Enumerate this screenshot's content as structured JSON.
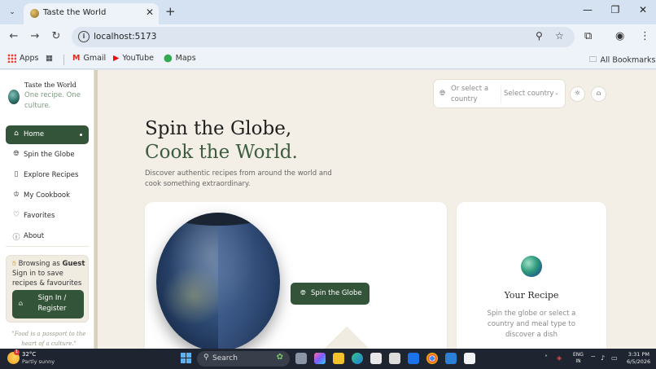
{
  "browser": {
    "tab_title": "Taste the World",
    "tab_close": "✕",
    "new_tab": "+",
    "url": "localhost:5173",
    "bookmarks": {
      "apps": "Apps",
      "gmail": "Gmail",
      "youtube": "YouTube",
      "maps": "Maps",
      "all_bookmarks": "All Bookmarks"
    }
  },
  "sidebar": {
    "brand_name": "Taste the World",
    "tagline": "One recipe. One culture.",
    "nav": [
      {
        "label": "Home",
        "icon": "home-icon"
      },
      {
        "label": "Spin the Globe",
        "icon": "globe-icon"
      },
      {
        "label": "Explore Recipes",
        "icon": "book-icon"
      },
      {
        "label": "My Cookbook",
        "icon": "chef-hat-icon"
      },
      {
        "label": "Favorites",
        "icon": "heart-icon"
      },
      {
        "label": "About",
        "icon": "info-icon"
      }
    ],
    "guest": {
      "prefix": "Browsing as ",
      "role": "Guest",
      "message": "Sign in to save recipes & favourites",
      "signin_label": "Sign In / Register"
    },
    "quote": "\"Food is a passport to the heart of a culture.\""
  },
  "header": {
    "country_placeholder": "Or select a country",
    "country_select": "Select country"
  },
  "hero": {
    "title_line1": "Spin the Globe,",
    "title_line2": "Cook the World.",
    "description": "Discover authentic recipes from around the world and cook something extraordinary."
  },
  "globe_card": {
    "spin_label": "Spin the Globe"
  },
  "recipe_card": {
    "title": "Your Recipe",
    "description": "Spin the globe or select a country and meal type to discover a dish"
  },
  "taskbar": {
    "temperature": "32°C",
    "condition": "Partly sunny",
    "weather_badge": "1",
    "search_label": "Search",
    "lang_line1": "ENG",
    "lang_line2": "IN",
    "time": "3:31 PM",
    "date": "6/5/2026"
  },
  "colors": {
    "accent_green": "#34543a",
    "page_bg": "#f3efe6",
    "title_green": "#3d5c3f"
  }
}
